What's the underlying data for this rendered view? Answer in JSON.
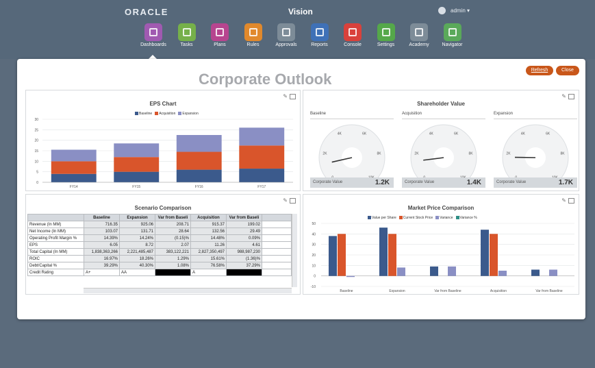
{
  "header": {
    "brand": "ORACLE",
    "app_title": "Vision",
    "user": "admin"
  },
  "nav": [
    {
      "label": "Dashboards",
      "color": "#a05ab1"
    },
    {
      "label": "Tasks",
      "color": "#76b04a"
    },
    {
      "label": "Plans",
      "color": "#b7458f"
    },
    {
      "label": "Rules",
      "color": "#e1892c"
    },
    {
      "label": "Approvals",
      "color": "#7d8c98"
    },
    {
      "label": "Reports",
      "color": "#3f71b7"
    },
    {
      "label": "Console",
      "color": "#d9413b"
    },
    {
      "label": "Settings",
      "color": "#55a84a"
    },
    {
      "label": "Academy",
      "color": "#7d8c98"
    },
    {
      "label": "Navigator",
      "color": "#5aa95a"
    }
  ],
  "page": {
    "title": "Corporate Outlook",
    "refresh_label": "Refresh",
    "close_label": "Close"
  },
  "eps": {
    "title": "EPS Chart",
    "legend": [
      "Baseline",
      "Acquisition",
      "Expansion"
    ],
    "colors": [
      "#3b5a8c",
      "#d9552b",
      "#8a8fc4"
    ],
    "chart_data": {
      "type": "bar",
      "stacked": true,
      "categories": [
        "FY14",
        "FY15",
        "FY16",
        "FY17"
      ],
      "series": [
        {
          "name": "Baseline",
          "values": [
            4,
            5,
            6,
            6.5
          ]
        },
        {
          "name": "Acquisition",
          "values": [
            6,
            7,
            8.5,
            11
          ]
        },
        {
          "name": "Expansion",
          "values": [
            5.5,
            6.5,
            8,
            8.5
          ]
        }
      ],
      "ylim": [
        0,
        30
      ],
      "yticks": [
        "0",
        "5",
        "10",
        "15",
        "20",
        "25",
        "30"
      ]
    }
  },
  "shareholder": {
    "title": "Shareholder Value",
    "gauges": [
      {
        "name": "Baseline",
        "caption": "Corporate Value",
        "value": "1.2K",
        "level": 0.12
      },
      {
        "name": "Acquisition",
        "caption": "Corporate Value",
        "value": "1.4K",
        "level": 0.14
      },
      {
        "name": "Expansion",
        "caption": "Corporate Value",
        "value": "1.7K",
        "level": 0.17
      }
    ],
    "ticks": [
      "0",
      "2K",
      "4K",
      "6K",
      "8K",
      "10K"
    ]
  },
  "scenario": {
    "title": "Scenario Comparison",
    "columns": [
      "",
      "Baseline",
      "Expansion",
      "Var from Baseli",
      "Acquisition",
      "Var from Baseli"
    ],
    "rows": [
      [
        "Revenue (In MM)",
        "716.35",
        "925.06",
        "208.71",
        "915.37",
        "199.02"
      ],
      [
        "Net Income (In MM)",
        "103.07",
        "131.71",
        "28.64",
        "132.56",
        "29.49"
      ],
      [
        "Operating Profit Margin %",
        "14.39%",
        "14.24%",
        "(0.15)%",
        "14.48%",
        "0.09%"
      ],
      [
        "EPS",
        "6.05",
        "8.72",
        "2.07",
        "11.26",
        "4.61"
      ],
      [
        "Total Capital (In MM)",
        "1,838,363,266",
        "2,221,485,487",
        "383,122,221",
        "2,827,350,497",
        "988,987,230"
      ],
      [
        "ROIC",
        "16.97%",
        "18.26%",
        "1.29%",
        "15.61%",
        "(1.36)%"
      ],
      [
        "Debt/Capital %",
        "39.29%",
        "40.30%",
        "1.08%",
        "76.58%",
        "37.29%"
      ],
      [
        "Credit Rating",
        "A+",
        "AA",
        "",
        "A",
        ""
      ]
    ]
  },
  "market": {
    "title": "Market Price Comparison",
    "legend": [
      "Value per Share",
      "Current Stock Price",
      "Variance",
      "Variance %"
    ],
    "colors": [
      "#3b5a8c",
      "#d9552b",
      "#8a8fc4",
      "#2f8f86"
    ],
    "chart_data": {
      "type": "bar",
      "categories": [
        "Baseline",
        "Expansion",
        "Var from Baseline",
        "Acquisition",
        "Var from Baseline"
      ],
      "series": [
        {
          "name": "Value per Share",
          "values": [
            38,
            46,
            9,
            44,
            6
          ]
        },
        {
          "name": "Current Stock Price",
          "values": [
            40,
            40,
            0,
            40,
            0
          ]
        },
        {
          "name": "Variance",
          "values": [
            -1,
            8,
            9,
            5,
            6
          ]
        },
        {
          "name": "Variance %",
          "values": [
            0,
            0,
            0,
            0,
            0
          ]
        }
      ],
      "ylim": [
        -10,
        50
      ],
      "yticks": [
        "-10",
        "0",
        "10",
        "20",
        "30",
        "40",
        "50"
      ]
    }
  }
}
